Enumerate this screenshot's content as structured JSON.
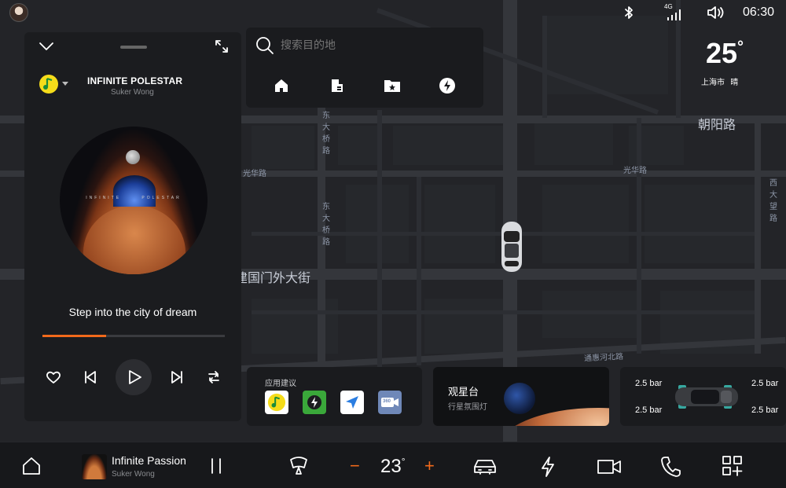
{
  "status_bar": {
    "signal_label": "4G",
    "time": "06:30"
  },
  "weather": {
    "temperature": "25",
    "degree_symbol": "°",
    "city": "上海市",
    "condition": "晴"
  },
  "map": {
    "labels": {
      "chaoyang_road": "朝阳路",
      "guanghua_road_left": "光华路",
      "guanghua_road_right": "光华路",
      "jianguomenwai": "建国门外大街",
      "tonghuihe_north": "通惠河北路",
      "dongdaqiao_1": "东大桥路",
      "dongdaqiao_2": "东大桥路",
      "xidawang": "西大望路"
    }
  },
  "search": {
    "placeholder": "搜索目的地",
    "shortcuts": [
      "home-icon",
      "office-icon",
      "favorites-icon",
      "charging-icon"
    ]
  },
  "music": {
    "track_title": "INFINITE POLESTAR",
    "artist": "Suker Wong",
    "album_art_text": "INFINITE      POLESTAR",
    "lyric": "Step into the city of dream",
    "progress": 0.35,
    "accent_color": "#f26a1b"
  },
  "app_suggestions": {
    "title": "应用建议",
    "apps": [
      {
        "name": "music-app-icon",
        "color": "#ffffff"
      },
      {
        "name": "charging-app-icon",
        "color": "#3aa83a"
      },
      {
        "name": "navigation-app-icon",
        "color": "#ffffff"
      },
      {
        "name": "camera-360-app-icon",
        "color": "#6f88b8",
        "label": "360"
      }
    ]
  },
  "stargazing": {
    "title": "观星台",
    "subtitle": "行星氛围灯"
  },
  "tire_pressure": {
    "front_left": "2.5 bar",
    "front_right": "2.5 bar",
    "rear_left": "2.5 bar",
    "rear_right": "2.5 bar"
  },
  "dock": {
    "now_playing_title": "Infinite Passion",
    "now_playing_artist": "Suker Wong",
    "temperature": "23",
    "degree_symbol": "°",
    "minus_label": "−",
    "plus_label": "+",
    "accent_color": "#f26a1b"
  }
}
